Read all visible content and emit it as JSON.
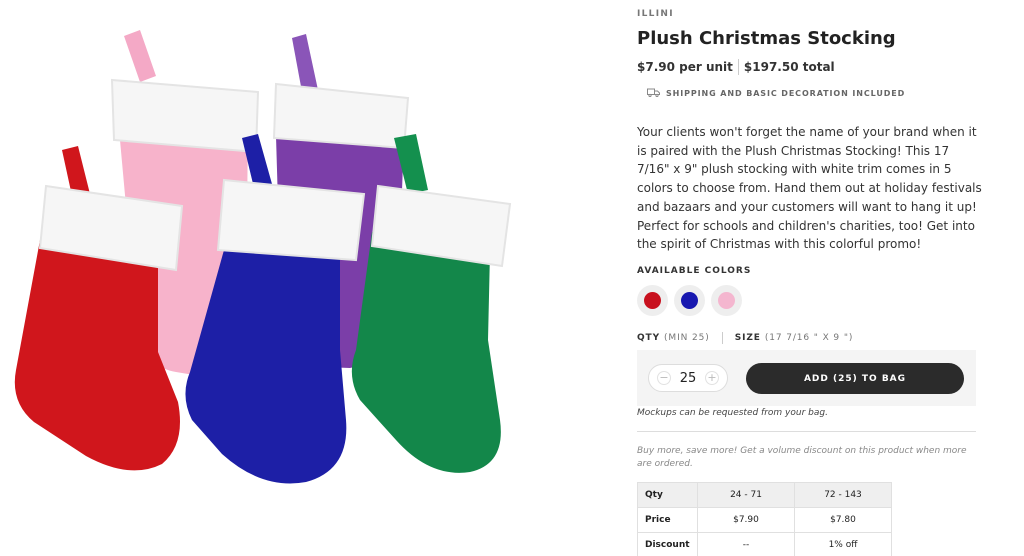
{
  "product": {
    "brand": "ILLINI",
    "title": "Plush Christmas Stocking",
    "price_unit": "$7.90 per unit",
    "price_total": "$197.50 total",
    "shipping_note": "SHIPPING AND BASIC DECORATION INCLUDED",
    "description": "Your clients won't forget the name of your brand when it is paired with the Plush Christmas Stocking! This 17 7/16\" x 9\" plush stocking with white trim comes in 5 colors to choose from. Hand them out at holiday festivals and bazaars and your customers will want to hang it up! Perfect for schools and children's charities, too! Get into the spirit of Christmas with this colorful promo!"
  },
  "colors": {
    "label": "AVAILABLE COLORS",
    "swatches": [
      {
        "name": "red",
        "hex": "#c8101e"
      },
      {
        "name": "blue",
        "hex": "#1818b0"
      },
      {
        "name": "pink",
        "hex": "#f4b6cf"
      }
    ]
  },
  "order": {
    "qty_label": "QTY",
    "qty_min": "(MIN 25)",
    "size_label": "SIZE",
    "size_value": "(17 7/16 \" X 9 \")",
    "quantity": "25",
    "minus": "−",
    "plus": "+",
    "add_button": "ADD (25) TO BAG",
    "mockups_note": "Mockups can be requested from your bag."
  },
  "volume": {
    "note": "Buy more, save more! Get a volume discount on this product when more are ordered.",
    "rows": [
      [
        "Qty",
        "24 - 71",
        "72 - 143"
      ],
      [
        "Price",
        "$7.90",
        "$7.80"
      ],
      [
        "Discount",
        "--",
        "1% off"
      ]
    ]
  },
  "icons": {
    "shipping": "truck-icon"
  },
  "stocking_colors": {
    "red": "#d0161c",
    "pink": "#f7b3cb",
    "purple": "#7b3ea8",
    "blue": "#1d1fa6",
    "green": "#13874a",
    "cuff": "#f7f7f7"
  }
}
